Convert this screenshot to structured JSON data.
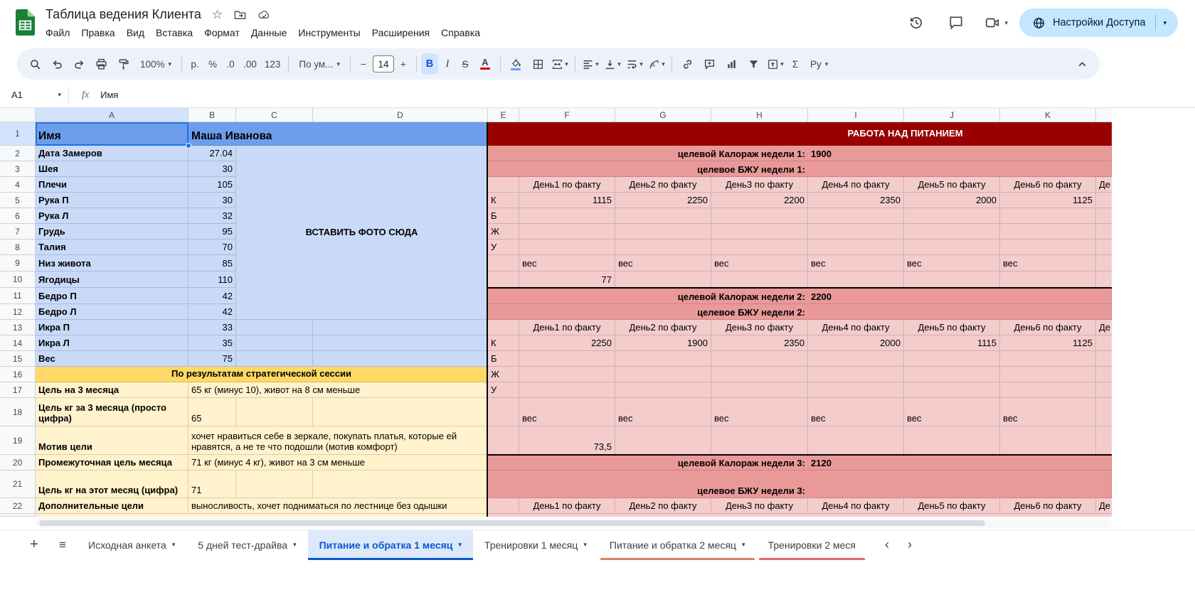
{
  "colors": {
    "accent": "#0b57d0",
    "selection": "#1a73e8",
    "toolbar-bg": "#edf2fa",
    "share-bg": "#c2e7ff",
    "share-text": "#001d35",
    "header-sel": "#d3e3fd",
    "active-btn-bg": "#d3e3fd",
    "cell-blue": "#6d9eeb",
    "cell-blue-light": "#c9daf8",
    "cell-yellow": "#ffd966",
    "cell-yellow-light": "#fff2cc",
    "cell-red": "#990000",
    "cell-salmon": "#ea9999",
    "cell-pink": "#f4cccc",
    "text-color-swatch": "#cc0000",
    "fill-color-swatch": "#6d9eeb"
  },
  "glyphs": {
    "caret": "▾",
    "star": "☆",
    "plus": "+",
    "menu": "≡",
    "chev_left": "‹",
    "chev_right": "›",
    "minus": "−"
  },
  "titlebar": {
    "title": "Таблица ведения Клиента",
    "menus": [
      "Файл",
      "Правка",
      "Вид",
      "Вставка",
      "Формат",
      "Данные",
      "Инструменты",
      "Расширения",
      "Справка"
    ],
    "share_button": "Настройки Доступа"
  },
  "toolbar": {
    "zoom": "100%",
    "currency": "р.",
    "percent": "%",
    "decimal_decrease": ".0",
    "decimal_increase": ".00",
    "plain_format": "123",
    "font_name": "По ум...",
    "font_size": "14",
    "bold": "B",
    "italic": "I",
    "strikethrough": "S",
    "text_color": "A",
    "functions": "Σ",
    "input_tools": "Ру"
  },
  "formula_bar": {
    "cell_ref": "A1",
    "fx": "fx",
    "value": "Имя"
  },
  "grid": {
    "column_headers": [
      "A",
      "B",
      "C",
      "D",
      "E",
      "F",
      "G",
      "H",
      "I",
      "J",
      "K"
    ],
    "row_headers": [
      "1",
      "2",
      "3",
      "4",
      "5",
      "6",
      "7",
      "8",
      "9",
      "10",
      "11",
      "12",
      "13",
      "14",
      "15",
      "16",
      "17",
      "18",
      "19",
      "20",
      "21",
      "22"
    ]
  },
  "sheet": {
    "left": {
      "name_label": "Имя",
      "name_value": "Маша Иванова",
      "photo_placeholder": "ВСТАВИТЬ ФОТО СЮДА",
      "measurements": [
        [
          "Дата Замеров",
          "27.04"
        ],
        [
          "Шея",
          "30"
        ],
        [
          "Плечи",
          "105"
        ],
        [
          "Рука П",
          "30"
        ],
        [
          "Рука Л",
          "32"
        ],
        [
          "Грудь",
          "95"
        ],
        [
          "Талия",
          "70"
        ],
        [
          "Низ живота",
          "85"
        ],
        [
          "Ягодицы",
          "110"
        ],
        [
          "Бедро П",
          "42"
        ],
        [
          "Бедро Л",
          "42"
        ],
        [
          "Икра П",
          "33"
        ],
        [
          "Икра Л",
          "35"
        ],
        [
          "Вес",
          "75"
        ]
      ],
      "strategy_header": "По результатам стратегической сессии",
      "goals": [
        {
          "label": "Цель на 3 месяца",
          "value": "65 кг (минус 10), живот на 8 см меньше"
        },
        {
          "label": "Цель кг за 3 месяца (просто цифра)",
          "value": "65",
          "short": true
        },
        {
          "label": "Мотив цели",
          "value": "хочет нравиться себе в зеркале, покупать платья, которые ей нравятся, а не те что подошли (мотив комфорт)"
        },
        {
          "label": "Промежуточная цель месяца",
          "value": "71 кг (минус 4 кг), живот на 3 см меньше"
        },
        {
          "label": "Цель кг на этот месяц (цифра)",
          "value": "71",
          "short": true
        },
        {
          "label": "Дополнительные цели",
          "value": "выносливость, хочет подниматься по лестнице без одышки"
        }
      ]
    },
    "nutrition": {
      "title": "РАБОТА НАД ПИТАНИЕМ",
      "row_labels": [
        "К",
        "Б",
        "Ж",
        "У"
      ],
      "weight_label": "вес",
      "day_headers": [
        "День1 по факту",
        "День2 по факту",
        "День3 по факту",
        "День4 по факту",
        "День5 по факту",
        "День6 по факту",
        "Де"
      ],
      "weeks": [
        {
          "kcal_label": "целевой Калораж недели 1:",
          "kcal_value": "1900",
          "bju_label": "целевое БЖУ недели 1:",
          "k_values": [
            "1115",
            "2250",
            "2200",
            "2350",
            "2000",
            "1125"
          ],
          "weight_value": "77"
        },
        {
          "kcal_label": "целевой Калораж недели 2:",
          "kcal_value": "2200",
          "bju_label": "целевое БЖУ недели 2:",
          "k_values": [
            "2250",
            "1900",
            "2350",
            "2000",
            "1115",
            "1125"
          ],
          "weight_value": "73,5"
        },
        {
          "kcal_label": "целевой Калораж недели 3:",
          "kcal_value": "2120",
          "bju_label": "целевое БЖУ недели 3:"
        }
      ]
    }
  },
  "tabbar": {
    "tabs": [
      {
        "label": "Исходная анкета",
        "caret": true
      },
      {
        "label": "5 дней тест-драйва",
        "caret": true
      },
      {
        "label": "Питание и обратка 1 месяц",
        "caret": true,
        "active": true
      },
      {
        "label": "Тренировки 1 месяц",
        "caret": true
      },
      {
        "label": "Питание и обратка 2 месяц",
        "caret": true,
        "strip": "#dd7e6b"
      },
      {
        "label": "Тренировки 2 меся",
        "caret": false,
        "strip": "#e06666"
      }
    ]
  }
}
